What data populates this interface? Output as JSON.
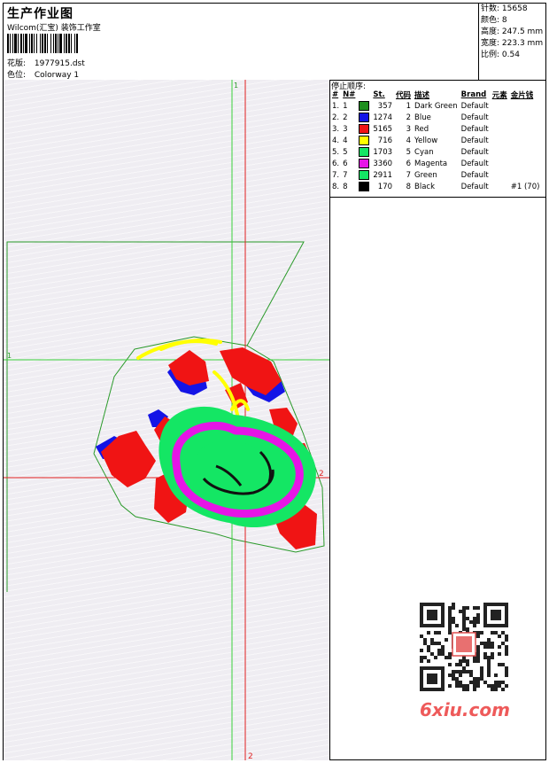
{
  "header": {
    "title": "生产作业图",
    "company": "Wilcom(汇宝) 装饰工作室",
    "design_label": "花版:",
    "design_value": "1977915.dst",
    "colorway_label": "色位:",
    "colorway_value": "Colorway 1"
  },
  "stats": [
    {
      "label": "针数",
      "value": "15658"
    },
    {
      "label": "颜色",
      "value": "8"
    },
    {
      "label": "高度",
      "value": "247.5 mm"
    },
    {
      "label": "宽度",
      "value": "223.3 mm"
    },
    {
      "label": "比例",
      "value": "0.54"
    }
  ],
  "canvas": {
    "axis_labels": {
      "top": "1",
      "left": "1",
      "right": "2",
      "bottom": "2"
    }
  },
  "stop_sequence": {
    "title": "停止顺序:",
    "columns": [
      "#",
      "N#",
      "St.",
      "代码",
      "描述",
      "Brand",
      "元素",
      "金片钱"
    ],
    "rows": [
      {
        "num": "1.",
        "n": "1",
        "color": "#1f8f1f",
        "st": "357",
        "code": "1",
        "desc": "Dark Green",
        "brand": "Default",
        "extra": ""
      },
      {
        "num": "2.",
        "n": "2",
        "color": "#1414e6",
        "st": "1274",
        "code": "2",
        "desc": "Blue",
        "brand": "Default",
        "extra": ""
      },
      {
        "num": "3.",
        "n": "3",
        "color": "#f01414",
        "st": "5165",
        "code": "3",
        "desc": "Red",
        "brand": "Default",
        "extra": ""
      },
      {
        "num": "4.",
        "n": "4",
        "color": "#ffff00",
        "st": "716",
        "code": "4",
        "desc": "Yellow",
        "brand": "Default",
        "extra": ""
      },
      {
        "num": "5.",
        "n": "5",
        "color": "#14e664",
        "st": "1703",
        "code": "5",
        "desc": "Cyan",
        "brand": "Default",
        "extra": ""
      },
      {
        "num": "6.",
        "n": "6",
        "color": "#e614e6",
        "st": "3360",
        "code": "6",
        "desc": "Magenta",
        "brand": "Default",
        "extra": ""
      },
      {
        "num": "7.",
        "n": "7",
        "color": "#14e664",
        "st": "2911",
        "code": "7",
        "desc": "Green",
        "brand": "Default",
        "extra": ""
      },
      {
        "num": "8.",
        "n": "8",
        "color": "#000000",
        "st": "170",
        "code": "8",
        "desc": "Black",
        "brand": "Default",
        "extra": "#1 (70)"
      }
    ]
  },
  "watermark": {
    "site": "6xiu.com"
  }
}
